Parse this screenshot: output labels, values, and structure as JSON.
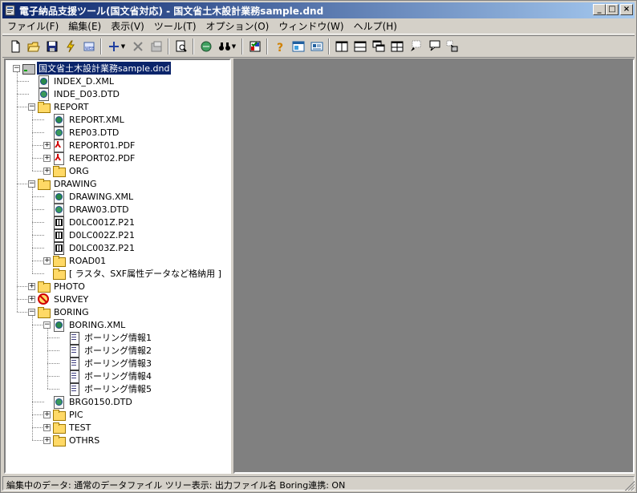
{
  "window": {
    "title": "電子納品支援ツール(国文省対応) - 国文省土木設計業務sample.dnd"
  },
  "menu": [
    {
      "label": "ファイル(F)",
      "name": "menu-file"
    },
    {
      "label": "編集(E)",
      "name": "menu-edit"
    },
    {
      "label": "表示(V)",
      "name": "menu-view"
    },
    {
      "label": "ツール(T)",
      "name": "menu-tools"
    },
    {
      "label": "オプション(O)",
      "name": "menu-options"
    },
    {
      "label": "ウィンドウ(W)",
      "name": "menu-window"
    },
    {
      "label": "ヘルプ(H)",
      "name": "menu-help"
    }
  ],
  "toolbar": [
    {
      "icon": "new-file-icon"
    },
    {
      "icon": "open-folder-icon"
    },
    {
      "icon": "save-icon"
    },
    {
      "icon": "lightning-icon"
    },
    {
      "icon": "web-icon"
    },
    {
      "sep": true
    },
    {
      "icon": "add-icon",
      "dropdown": true
    },
    {
      "icon": "delete-icon"
    },
    {
      "icon": "properties-icon"
    },
    {
      "sep": true
    },
    {
      "icon": "preview-icon"
    },
    {
      "sep": true
    },
    {
      "icon": "convert-icon"
    },
    {
      "icon": "binoculars-icon",
      "dropdown": true
    },
    {
      "sep": true
    },
    {
      "icon": "check-icon"
    },
    {
      "sep": true
    },
    {
      "icon": "help-icon"
    },
    {
      "icon": "panel-icon"
    },
    {
      "icon": "card-icon"
    },
    {
      "sep": true
    },
    {
      "icon": "layout-split-vertical-icon"
    },
    {
      "icon": "layout-split-horizontal-icon"
    },
    {
      "icon": "cascade-icon"
    },
    {
      "icon": "tile-icon"
    },
    {
      "icon": "window-select-icon"
    },
    {
      "icon": "balloon-icon"
    },
    {
      "icon": "arrange-icon"
    }
  ],
  "tree": [
    {
      "label": "国文省土木設計業務sample.dnd",
      "icon": "drive",
      "level": 0,
      "expander": "-",
      "selected": true
    },
    {
      "label": "INDEX_D.XML",
      "icon": "xml",
      "level": 1
    },
    {
      "label": "INDE_D03.DTD",
      "icon": "dtd",
      "level": 1
    },
    {
      "label": "REPORT",
      "icon": "folder",
      "level": 1,
      "expander": "-"
    },
    {
      "label": "REPORT.XML",
      "icon": "xml",
      "level": 2
    },
    {
      "label": "REP03.DTD",
      "icon": "dtd",
      "level": 2
    },
    {
      "label": "REPORT01.PDF",
      "icon": "pdf",
      "level": 2,
      "expander": "+"
    },
    {
      "label": "REPORT02.PDF",
      "icon": "pdf",
      "level": 2,
      "expander": "+"
    },
    {
      "label": "ORG",
      "icon": "folder",
      "level": 2,
      "expander": "+"
    },
    {
      "label": "DRAWING",
      "icon": "folder",
      "level": 1,
      "expander": "-"
    },
    {
      "label": "DRAWING.XML",
      "icon": "xml",
      "level": 2
    },
    {
      "label": "DRAW03.DTD",
      "icon": "dtd",
      "level": 2
    },
    {
      "label": "D0LC001Z.P21",
      "icon": "p21",
      "level": 2
    },
    {
      "label": "D0LC002Z.P21",
      "icon": "p21",
      "level": 2
    },
    {
      "label": "D0LC003Z.P21",
      "icon": "p21",
      "level": 2
    },
    {
      "label": "ROAD01",
      "icon": "folder",
      "level": 2,
      "expander": "+"
    },
    {
      "label": "[ ラスタ、SXF属性データなど格納用 ]",
      "icon": "folder",
      "level": 2
    },
    {
      "label": "PHOTO",
      "icon": "folder",
      "level": 1,
      "expander": "+"
    },
    {
      "label": "SURVEY",
      "icon": "noentry",
      "level": 1,
      "expander": "+"
    },
    {
      "label": "BORING",
      "icon": "folder",
      "level": 1,
      "expander": "-"
    },
    {
      "label": "BORING.XML",
      "icon": "xml",
      "level": 2,
      "expander": "-"
    },
    {
      "label": "ボーリング情報1",
      "icon": "doc",
      "level": 3
    },
    {
      "label": "ボーリング情報2",
      "icon": "doc",
      "level": 3
    },
    {
      "label": "ボーリング情報3",
      "icon": "doc",
      "level": 3
    },
    {
      "label": "ボーリング情報4",
      "icon": "doc",
      "level": 3
    },
    {
      "label": "ボーリング情報5",
      "icon": "doc",
      "level": 3
    },
    {
      "label": "BRG0150.DTD",
      "icon": "dtd",
      "level": 2
    },
    {
      "label": "PIC",
      "icon": "folder",
      "level": 2,
      "expander": "+"
    },
    {
      "label": "TEST",
      "icon": "folder",
      "level": 2,
      "expander": "+"
    },
    {
      "label": "OTHRS",
      "icon": "folder",
      "level": 2,
      "expander": "+"
    }
  ],
  "status": {
    "text": "編集中のデータ: 通常のデータファイル  ツリー表示: 出力ファイル名  Boring連携: ON"
  }
}
